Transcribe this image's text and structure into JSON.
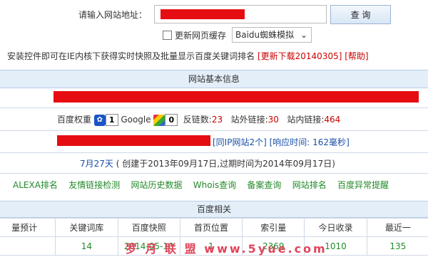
{
  "search": {
    "label": "请输入网站地址：",
    "button": "查 询"
  },
  "options": {
    "cache_checkbox_label": "更新网页缓存",
    "mode_select_value": "Baidu蜘蛛模拟"
  },
  "notice": {
    "text": "安装控件即可在IE内核下获得实时快照及批量显示百度关键词排名",
    "download_link": "[更新下载20140305]",
    "help_link": "[帮助]"
  },
  "basic_info": {
    "header": "网站基本信息",
    "baidu_weight_label": "百度权重",
    "baidu_weight_value": "1",
    "google_label": "Google",
    "google_value": "0",
    "backlinks_label": "反链数:",
    "backlinks_value": "23",
    "outlinks_label": "站外链接:",
    "outlinks_value": "30",
    "inlinks_label": "站内链接:",
    "inlinks_value": "464",
    "same_ip_link": "[同IP网站2个]",
    "response_prefix": "[响应时间: ",
    "response_value": "162毫秒",
    "response_suffix": "]",
    "age_days": "7月27天",
    "age_detail": "( 创建于2013年09月17日,过期时间为2014年09月17日)",
    "tools": [
      "ALEXA排名",
      "友情链接检测",
      "网站历史数据",
      "Whois查询",
      "备案查询",
      "网站排名",
      "百度异常提醒"
    ]
  },
  "baidu_related": {
    "header": "百度相关",
    "columns": [
      "量预计",
      "关键词库",
      "百度快照",
      "首页位置",
      "索引量",
      "今日收录",
      "最近一"
    ],
    "values": [
      "",
      "14",
      "2014-05-10",
      "1",
      "2369",
      "1010",
      "135"
    ]
  },
  "watermark": "罗 月 联 盟 www.5yue.com"
}
